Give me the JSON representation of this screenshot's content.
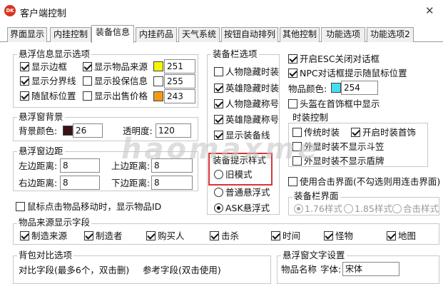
{
  "window": {
    "title": "客户端控制",
    "icon_text": "DK",
    "close": "✕"
  },
  "tabs": [
    "界面显示",
    "内挂控制",
    "装备信息",
    "内挂药品",
    "天气系统",
    "按钮自动排列",
    "其他控制",
    "功能选项",
    "功能选项2"
  ],
  "active_tab": 2,
  "float_info": {
    "title": "悬浮信息显示选项",
    "show_border": "显示边框",
    "show_divider": "显示分界线",
    "follow_mouse": "随鼠标位置",
    "show_source": "显示物品来源",
    "show_delivery": "显示投保信息",
    "show_price": "显示出售价格",
    "color1": "251",
    "color2": "255",
    "color3": "243",
    "color1_hex": "#f5f500",
    "color2_hex": "#ffffff",
    "color3_hex": "#f39a16"
  },
  "float_bg": {
    "title": "悬浮窗背景",
    "color_label": "背景颜色:",
    "color_value": "26",
    "color_hex": "#3a1414",
    "opacity_label": "透明度:",
    "opacity_value": "120"
  },
  "float_margin": {
    "title": "悬浮窗边距",
    "left": "左边距离:",
    "right": "右边距离:",
    "top": "上边距离:",
    "bottom": "下边距离:",
    "left_v": "8",
    "right_v": "8",
    "top_v": "8",
    "bottom_v": "8"
  },
  "mouse_click": "鼠标点击物品移动时，显示物品ID",
  "equip_bar": {
    "title": "装备栏选项",
    "hide_char_equip": "人物隐藏时装",
    "hero_hide_equip": "英雄隐藏时装",
    "char_hide_title": "人物隐藏称号",
    "hero_hide_title": "英雄隐藏称号",
    "show_line": "显示装备线"
  },
  "tooltip_style": {
    "title": "装备提示样式",
    "old": "旧模式",
    "normal": "普通悬浮式",
    "ask": "ASK悬浮式"
  },
  "right": {
    "esc_close": "开启ESC关闭对话框",
    "npc_follow": "NPC对话框提示随鼠标位置",
    "item_color_label": "物品颜色:",
    "item_color_value": "254",
    "item_color_hex": "#40e0f0",
    "helmet_show": "头盔在首饰框中显示"
  },
  "fashion": {
    "title": "时装控制",
    "trans": "传统时装",
    "open_jewelry": "开启时装首饰",
    "no_cape": "外显时装不显示斗笠",
    "no_shield": "外显时装不显示盾牌"
  },
  "combo": {
    "label": "使用合击界面(不勾选则用连击界面)"
  },
  "equip_ui": {
    "title": "装备栏界面",
    "v176": "1.76样式",
    "v185": "1.85样式",
    "combo": "合击样式"
  },
  "source_fields": {
    "title": "物品来源显示字段",
    "maker": "制造来源",
    "maker2": "制造者",
    "buyer": "购买人",
    "kill": "击杀",
    "time": "时间",
    "monster": "怪物",
    "map": "地图"
  },
  "bag_compare": {
    "title": "背包对比选项",
    "cmp": "对比字段(最多6个，双击删)",
    "ref": "参考字段(双击使用)"
  },
  "float_text": {
    "title": "悬浮窗文字设置",
    "item_name": "物品名称",
    "font_label": "字体:",
    "font_value": "宋体"
  },
  "watermark": "haomaxme"
}
